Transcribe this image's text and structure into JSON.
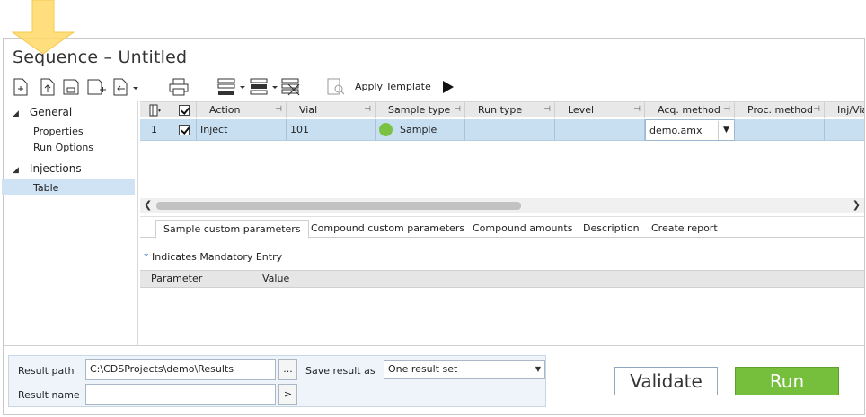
{
  "window": {
    "title": "Sequence – Untitled"
  },
  "toolbar": {
    "apply_template_label": "Apply Template",
    "icons": [
      "new-icon",
      "import-icon",
      "save-icon",
      "save-as-icon",
      "add-icon",
      "export-icon",
      "print-icon",
      "insert-rows-icon",
      "fill-down-icon",
      "delete-rows-icon",
      "template-icon",
      "run-play-icon"
    ]
  },
  "tree": {
    "groups": [
      {
        "label": "General",
        "items": [
          "Properties",
          "Run Options"
        ]
      },
      {
        "label": "Injections",
        "items": [
          "Table"
        ]
      }
    ],
    "selected": "Table"
  },
  "grid": {
    "columns": [
      "Action",
      "Vial",
      "Sample type",
      "Run type",
      "Level",
      "Acq. method",
      "Proc. method",
      "Inj/Via"
    ],
    "rows": [
      {
        "index": "1",
        "checked": true,
        "action": "Inject",
        "vial": "101",
        "sample_type": "Sample",
        "run_type": "",
        "level": "",
        "acq_method": "demo.amx",
        "proc_method": "",
        "inj_via": ""
      }
    ]
  },
  "tabs": [
    "Sample custom parameters",
    "Compound custom parameters",
    "Compound amounts",
    "Description",
    "Create report"
  ],
  "active_tab": "Sample custom parameters",
  "mandatory_note": {
    "star": "*",
    "text": " Indicates Mandatory Entry"
  },
  "param_table": {
    "headers": [
      "Parameter",
      "Value"
    ]
  },
  "result": {
    "path_label": "Result path",
    "path_value": "C:\\CDSProjects\\demo\\Results",
    "browse_label": "...",
    "name_label": "Result name",
    "name_value": "",
    "name_btn_label": ">",
    "save_as_label": "Save result as",
    "save_as_value": "One result set"
  },
  "buttons": {
    "validate": "Validate",
    "run": "Run"
  },
  "colors": {
    "accent_row": "#c8dff2",
    "run_green": "#76bf3c",
    "sample_dot": "#7cc242",
    "highlight_arrow": "#ffd966"
  }
}
